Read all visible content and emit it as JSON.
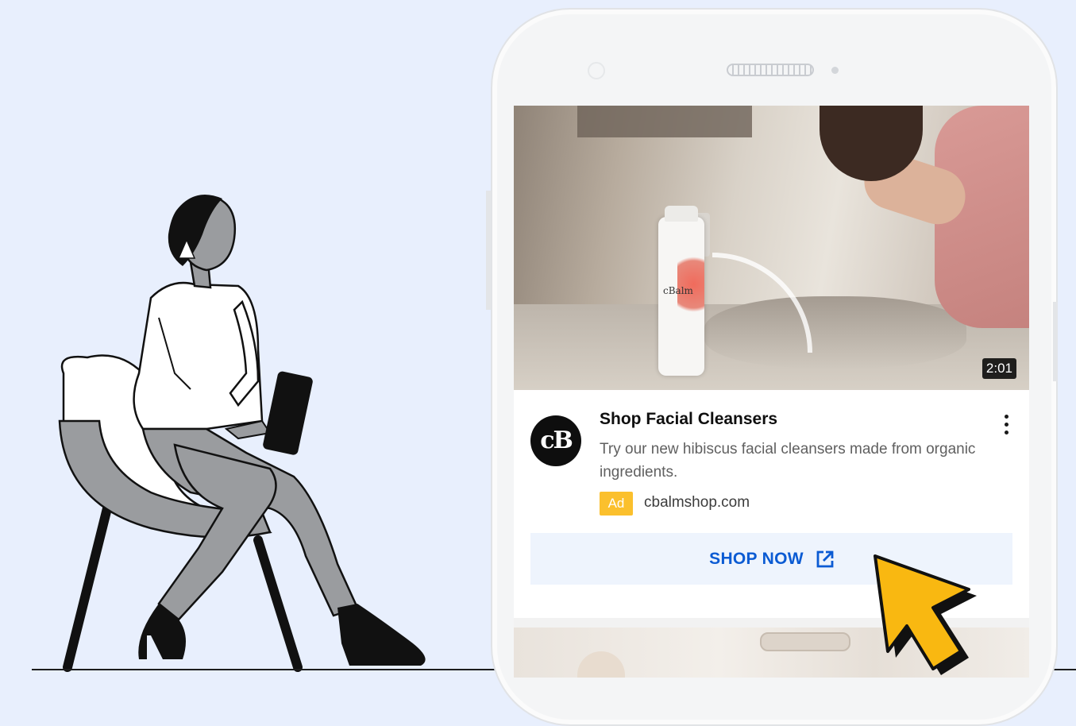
{
  "video": {
    "duration": "2:01",
    "product_brand": "cBalm"
  },
  "ad": {
    "logo_text": "cB",
    "title": "Shop Facial Cleansers",
    "description": "Try our new hibiscus facial cleansers made from organic ingredients.",
    "badge": "Ad",
    "domain": "cbalmshop.com",
    "cta_label": "SHOP NOW",
    "cta_icon": "external-link-icon",
    "menu_icon": "more-vert-icon"
  },
  "colors": {
    "background": "#e8effd",
    "badge": "#fbc02d",
    "cta_text": "#0b5bd3",
    "cta_background": "#eef4fd",
    "cursor": "#f9b811"
  }
}
